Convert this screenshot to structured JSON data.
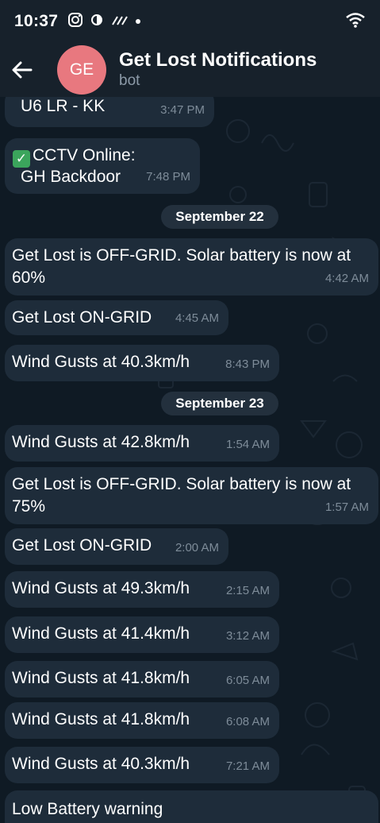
{
  "status_bar": {
    "time": "10:37",
    "icons": [
      "instagram-icon",
      "data-saver-icon",
      "signal-icon",
      "dot-icon",
      "wifi-icon"
    ]
  },
  "header": {
    "avatar_initials": "GE",
    "title": "Get Lost Notifications",
    "subtitle": "bot",
    "avatar_color": "#e8787f"
  },
  "messages": [
    {
      "text": "U6 LR - KK",
      "time": "3:47 PM"
    },
    {
      "line1": "CCTV Online:",
      "line2": "GH Backdoor",
      "time": "7:48 PM"
    },
    {
      "date": "September 22"
    },
    {
      "line1": "Get Lost is OFF-GRID. Solar battery is now at",
      "line2": "60%",
      "time": "4:42 AM"
    },
    {
      "text": "Get Lost ON-GRID",
      "time": "4:45 AM"
    },
    {
      "text": "Wind Gusts at 40.3km/h",
      "time": "8:43 PM"
    },
    {
      "date": "September 23"
    },
    {
      "text": "Wind Gusts at 42.8km/h",
      "time": "1:54 AM"
    },
    {
      "line1": "Get Lost is OFF-GRID. Solar battery is now at",
      "line2": "75%",
      "time": "1:57 AM"
    },
    {
      "text": "Get Lost ON-GRID",
      "time": "2:00 AM"
    },
    {
      "text": "Wind Gusts at 49.3km/h",
      "time": "2:15 AM"
    },
    {
      "text": "Wind Gusts at 41.4km/h",
      "time": "3:12 AM"
    },
    {
      "text": "Wind Gusts at 41.8km/h",
      "time": "6:05 AM"
    },
    {
      "text": "Wind Gusts at 41.8km/h",
      "time": "6:08 AM"
    },
    {
      "text": "Wind Gusts at 40.3km/h",
      "time": "7:21 AM"
    },
    {
      "text": "Low Battery warning"
    }
  ],
  "colors": {
    "background": "#0e1621",
    "bubble": "#1e2c3a",
    "header": "#17212b"
  }
}
